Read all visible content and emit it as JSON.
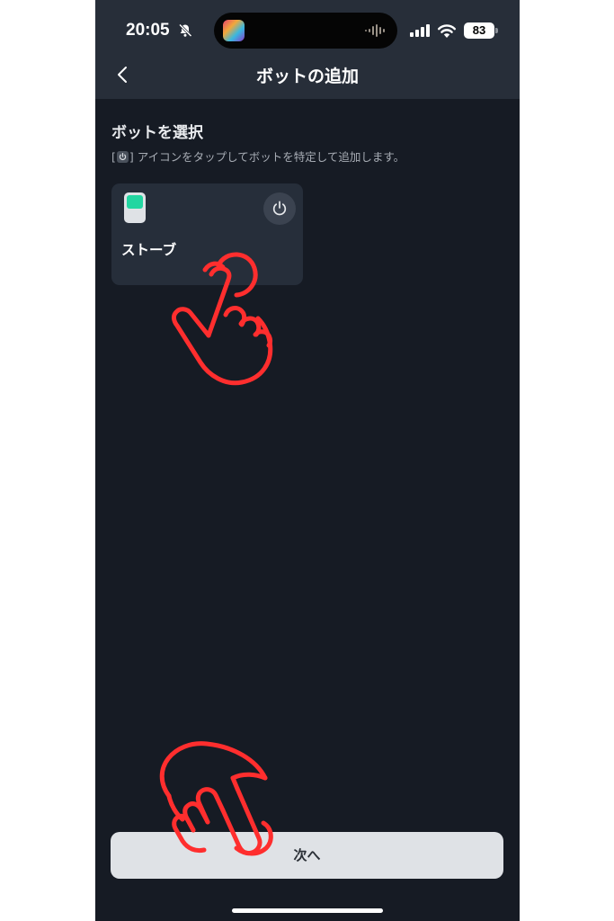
{
  "status_bar": {
    "time": "20:05",
    "battery": "83",
    "icons": [
      "bell-slash-icon",
      "app-icon",
      "audio-wave-icon",
      "signal-icon",
      "wifi-icon",
      "battery-icon"
    ]
  },
  "header": {
    "title": "ボットの追加",
    "back_icon": "chevron-left-icon"
  },
  "section": {
    "title": "ボットを選択",
    "hint_before": "[",
    "hint_after": "] アイコンをタップしてボットを特定して追加します。"
  },
  "devices": [
    {
      "name": "ストーブ",
      "icon": "bot-device-icon",
      "action_icon": "power-icon",
      "accent": "#22d6a1"
    }
  ],
  "footer": {
    "next_label": "次へ"
  },
  "annotations": {
    "overlay_color": "#ff3b3b",
    "icons": [
      "pointing-hand-icon",
      "pointing-hand-icon"
    ]
  }
}
